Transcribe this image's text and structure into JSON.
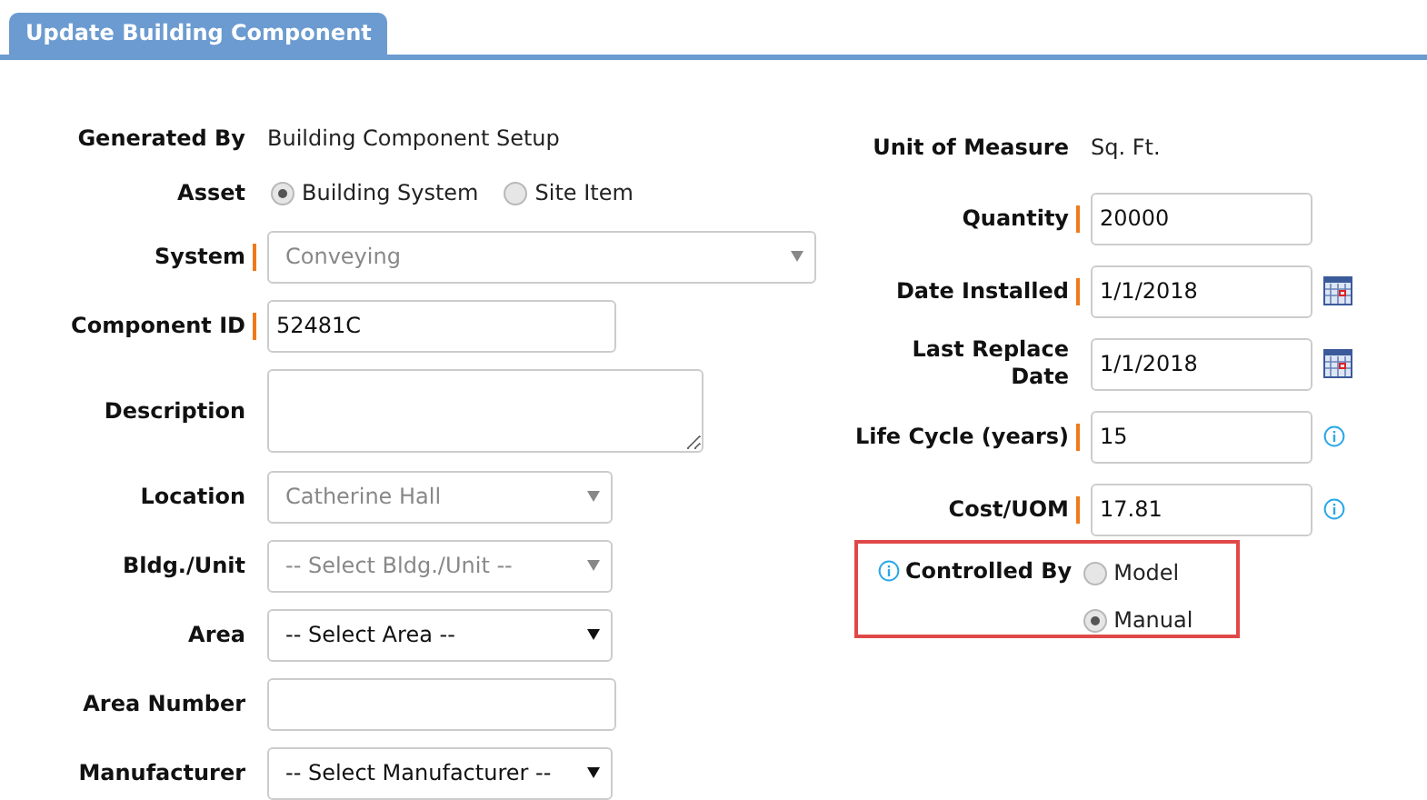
{
  "tab": {
    "label": "Update Building Component",
    "selected": true
  },
  "left_fields": [
    {
      "kind": "text",
      "label": "Generated By",
      "value": "Building Component Setup"
    },
    {
      "kind": "radio",
      "label": "Asset",
      "options": [
        {
          "label": "Building System",
          "selected": true
        },
        {
          "label": "Site Item",
          "selected": false
        }
      ]
    },
    {
      "kind": "wide_select",
      "label": "System",
      "required": true,
      "value": "Conveying",
      "disabled": true
    },
    {
      "kind": "input",
      "label": "Component ID",
      "required": true,
      "value": "52481C"
    },
    {
      "kind": "textarea",
      "label": "Description",
      "required": false
    },
    {
      "kind": "select",
      "label": "Location",
      "required": false,
      "value": "Catherine Hall",
      "disabled": true
    },
    {
      "kind": "select",
      "label": "Bldg./Unit",
      "required": false,
      "value": "-- Select Bldg./Unit --",
      "disabled": true
    },
    {
      "kind": "select",
      "label": "Area",
      "required": false,
      "value": "-- Select Area --",
      "disabled": false
    },
    {
      "kind": "input",
      "label": "Area Number",
      "required": false
    },
    {
      "kind": "select",
      "label": "Manufacturer",
      "required": false,
      "value": "-- Select Manufacturer --",
      "disabled": false
    }
  ],
  "right_fields": [
    {
      "kind": "text",
      "label": "Unit of Measure",
      "value": "Sq. Ft."
    },
    {
      "kind": "input",
      "label": "Quantity",
      "required": true,
      "value": "20000"
    },
    {
      "kind": "date",
      "label": "Date Installed",
      "required": true,
      "value": "1/1/2018"
    },
    {
      "kind": "date",
      "label": "Last Replace Date",
      "required": false,
      "value": "1/1/2018"
    },
    {
      "kind": "input",
      "label": "Life Cycle (years)",
      "required": true,
      "value": "15",
      "info": true
    },
    {
      "kind": "input",
      "label": "Cost/UOM",
      "required": true,
      "value": "17.81",
      "info": true
    }
  ],
  "controlled_by": {
    "label": "Controlled By",
    "options": [
      {
        "label": "Model",
        "selected": false
      },
      {
        "label": "Manual",
        "selected": true
      }
    ]
  }
}
